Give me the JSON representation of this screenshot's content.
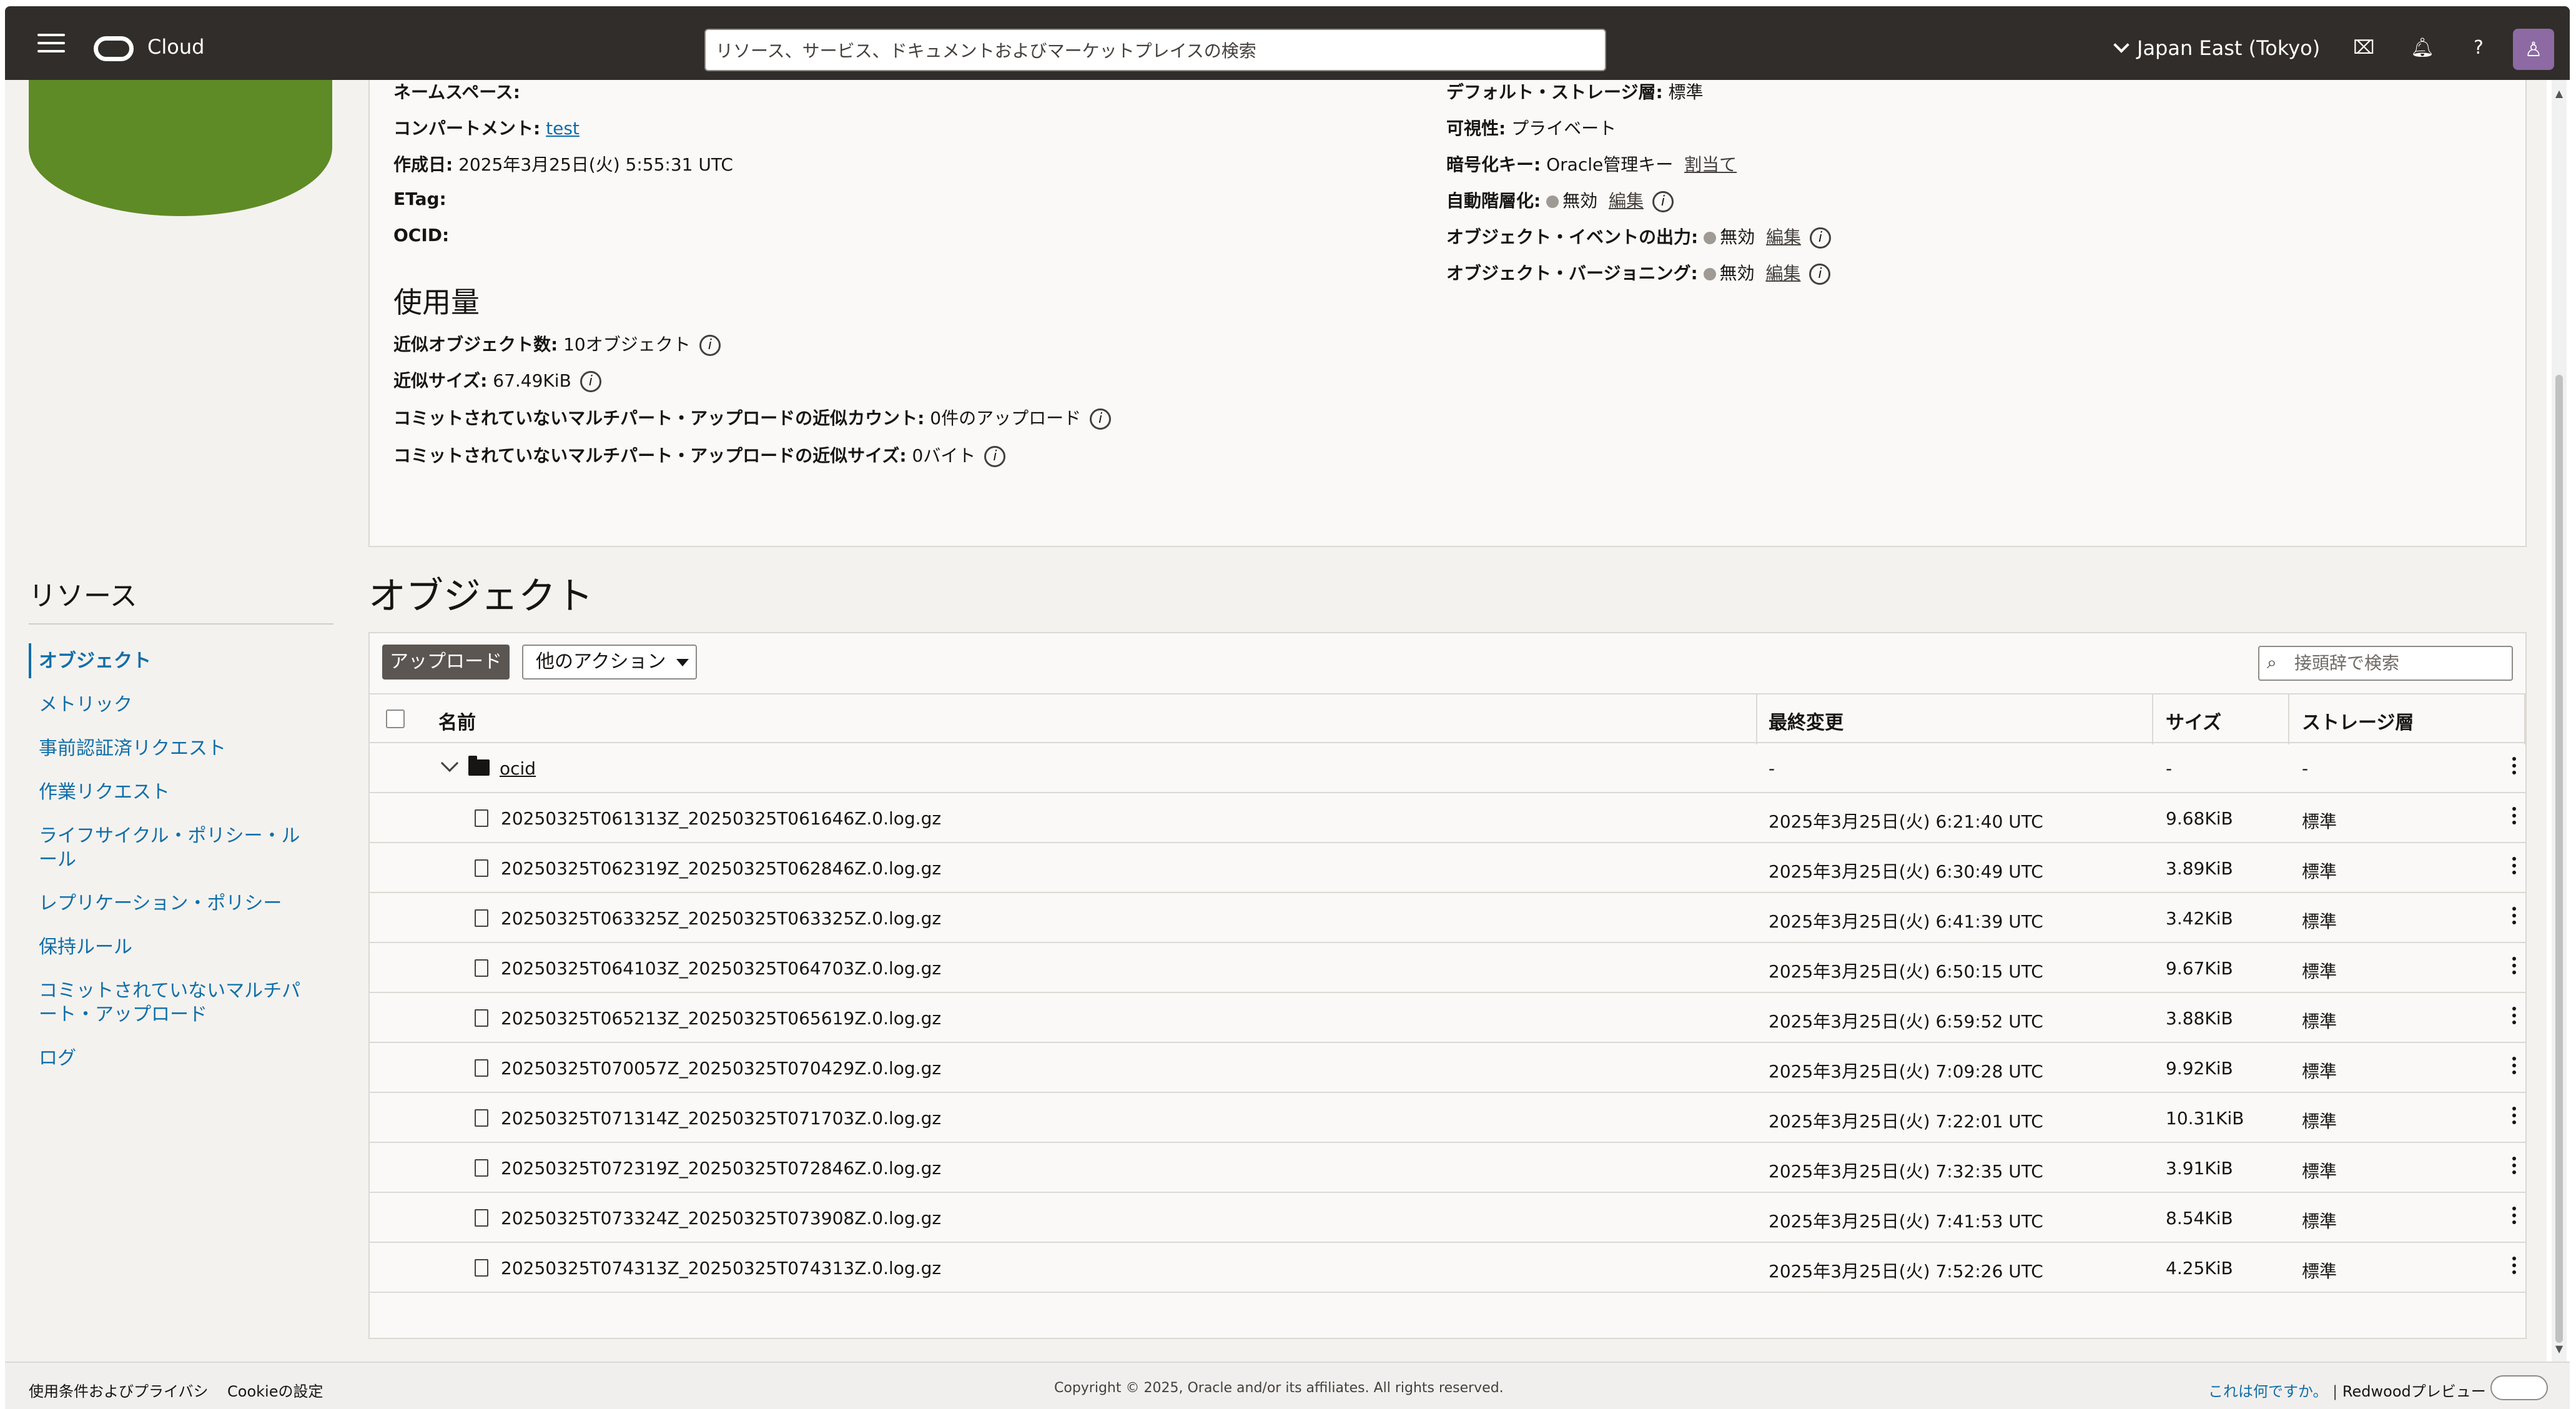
{
  "header": {
    "brand": "Cloud",
    "search_placeholder": "リソース、サービス、ドキュメントおよびマーケットプレイスの検索",
    "region": "Japan East (Tokyo)"
  },
  "details": {
    "namespace_label": "ネームスペース:",
    "compartment_label": "コンパートメント:",
    "compartment_value": "test",
    "created_label": "作成日:",
    "created_value": "2025年3月25日(火) 5:55:31 UTC",
    "etag_label": "ETag:",
    "ocid_label": "OCID:",
    "storage_tier_label": "デフォルト・ストレージ層:",
    "storage_tier_value": "標準",
    "visibility_label": "可視性:",
    "visibility_value": "プライベート",
    "encryption_label": "暗号化キー:",
    "encryption_value": "Oracle管理キー",
    "encryption_link": "割当て",
    "auto_tiering_label": "自動階層化:",
    "auto_tiering_value": "無効",
    "auto_tiering_link": "編集",
    "object_events_label": "オブジェクト・イベントの出力:",
    "object_events_value": "無効",
    "object_events_link": "編集",
    "versioning_label": "オブジェクト・バージョニング:",
    "versioning_value": "無効",
    "versioning_link": "編集"
  },
  "usage": {
    "title": "使用量",
    "object_count_label": "近似オブジェクト数:",
    "object_count_value": "10オブジェクト",
    "size_label": "近似サイズ:",
    "size_value": "67.49KiB",
    "multipart_count_label": "コミットされていないマルチパート・アップロードの近似カウント:",
    "multipart_count_value": "0件のアップロード",
    "multipart_size_label": "コミットされていないマルチパート・アップロードの近似サイズ:",
    "multipart_size_value": "0バイト"
  },
  "resources": {
    "title": "リソース",
    "items": [
      {
        "label": "オブジェクト"
      },
      {
        "label": "メトリック"
      },
      {
        "label": "事前認証済リクエスト"
      },
      {
        "label": "作業リクエスト"
      },
      {
        "label": "ライフサイクル・ポリシー・ルール"
      },
      {
        "label": "レプリケーション・ポリシー"
      },
      {
        "label": "保持ルール"
      },
      {
        "label": "コミットされていないマルチパート・アップロード"
      },
      {
        "label": "ログ"
      }
    ]
  },
  "objects": {
    "title": "オブジェクト",
    "upload_label": "アップロード",
    "actions_label": "他のアクション",
    "filter_placeholder": "接頭辞で検索",
    "columns": {
      "name": "名前",
      "modified": "最終変更",
      "size": "サイズ",
      "tier": "ストレージ層"
    },
    "folder": {
      "name": "ocid",
      "modified": "-",
      "size": "-",
      "tier": "-"
    },
    "rows": [
      {
        "name": "20250325T061313Z_20250325T061646Z.0.log.gz",
        "modified": "2025年3月25日(火) 6:21:40 UTC",
        "size": "9.68KiB",
        "tier": "標準"
      },
      {
        "name": "20250325T062319Z_20250325T062846Z.0.log.gz",
        "modified": "2025年3月25日(火) 6:30:49 UTC",
        "size": "3.89KiB",
        "tier": "標準"
      },
      {
        "name": "20250325T063325Z_20250325T063325Z.0.log.gz",
        "modified": "2025年3月25日(火) 6:41:39 UTC",
        "size": "3.42KiB",
        "tier": "標準"
      },
      {
        "name": "20250325T064103Z_20250325T064703Z.0.log.gz",
        "modified": "2025年3月25日(火) 6:50:15 UTC",
        "size": "9.67KiB",
        "tier": "標準"
      },
      {
        "name": "20250325T065213Z_20250325T065619Z.0.log.gz",
        "modified": "2025年3月25日(火) 6:59:52 UTC",
        "size": "3.88KiB",
        "tier": "標準"
      },
      {
        "name": "20250325T070057Z_20250325T070429Z.0.log.gz",
        "modified": "2025年3月25日(火) 7:09:28 UTC",
        "size": "9.92KiB",
        "tier": "標準"
      },
      {
        "name": "20250325T071314Z_20250325T071703Z.0.log.gz",
        "modified": "2025年3月25日(火) 7:22:01 UTC",
        "size": "10.31KiB",
        "tier": "標準"
      },
      {
        "name": "20250325T072319Z_20250325T072846Z.0.log.gz",
        "modified": "2025年3月25日(火) 7:32:35 UTC",
        "size": "3.91KiB",
        "tier": "標準"
      },
      {
        "name": "20250325T073324Z_20250325T073908Z.0.log.gz",
        "modified": "2025年3月25日(火) 7:41:53 UTC",
        "size": "8.54KiB",
        "tier": "標準"
      },
      {
        "name": "20250325T074313Z_20250325T074313Z.0.log.gz",
        "modified": "2025年3月25日(火) 7:52:26 UTC",
        "size": "4.25KiB",
        "tier": "標準"
      }
    ]
  },
  "footer": {
    "terms": "使用条件およびプライバシ",
    "cookies": "Cookieの設定",
    "copyright": "Copyright © 2025, Oracle and/or its affiliates. All rights reserved.",
    "whats_this": "これは何ですか。",
    "redwood": "Redwoodプレビュー"
  }
}
